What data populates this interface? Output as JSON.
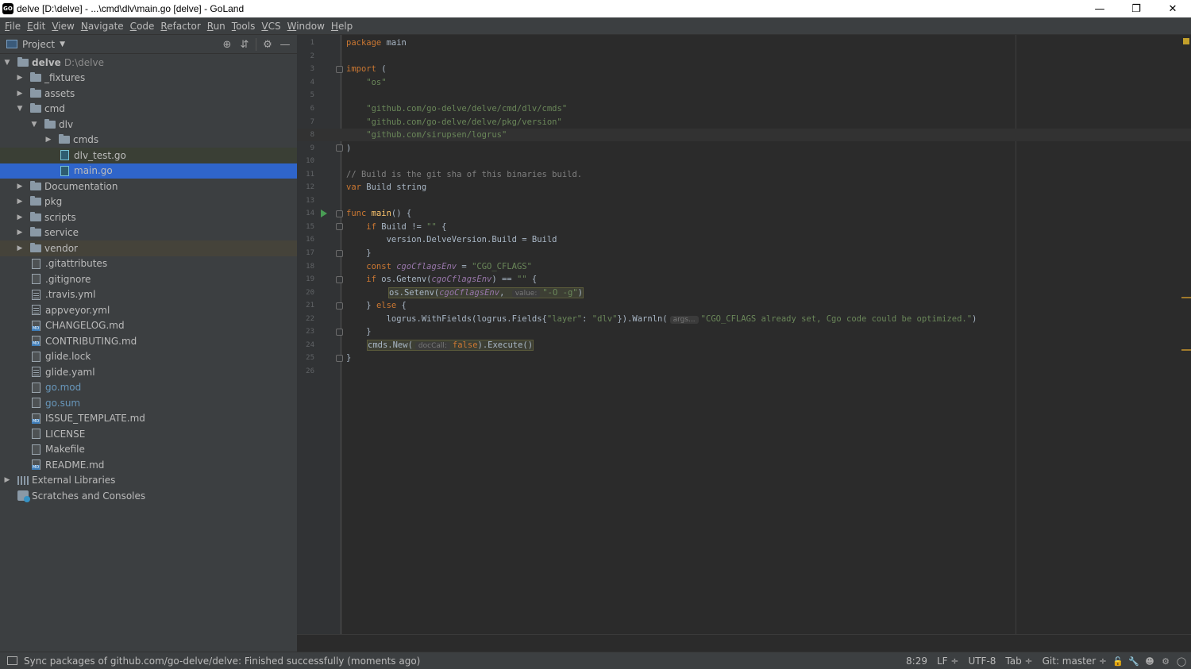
{
  "window": {
    "title": "delve [D:\\delve] - ...\\cmd\\dlv\\main.go [delve] - GoLand",
    "app_icon": "GO",
    "minimize": "—",
    "restore": "❐",
    "close": "✕"
  },
  "menu": [
    "File",
    "Edit",
    "View",
    "Navigate",
    "Code",
    "Refactor",
    "Run",
    "Tools",
    "VCS",
    "Window",
    "Help"
  ],
  "project": {
    "header": "Project",
    "root": {
      "name": "delve",
      "path": "D:\\delve"
    },
    "items": [
      {
        "label": "_fixtures"
      },
      {
        "label": "assets"
      },
      {
        "label": "cmd"
      },
      {
        "label": "dlv"
      },
      {
        "label": "cmds"
      },
      {
        "label": "dlv_test.go"
      },
      {
        "label": "main.go"
      },
      {
        "label": "Documentation"
      },
      {
        "label": "pkg"
      },
      {
        "label": "scripts"
      },
      {
        "label": "service"
      },
      {
        "label": "vendor"
      },
      {
        "label": ".gitattributes"
      },
      {
        "label": ".gitignore"
      },
      {
        "label": ".travis.yml"
      },
      {
        "label": "appveyor.yml"
      },
      {
        "label": "CHANGELOG.md"
      },
      {
        "label": "CONTRIBUTING.md"
      },
      {
        "label": "glide.lock"
      },
      {
        "label": "glide.yaml"
      },
      {
        "label": "go.mod"
      },
      {
        "label": "go.sum"
      },
      {
        "label": "ISSUE_TEMPLATE.md"
      },
      {
        "label": "LICENSE"
      },
      {
        "label": "Makefile"
      },
      {
        "label": "README.md"
      },
      {
        "label": "External Libraries"
      },
      {
        "label": "Scratches and Consoles"
      }
    ]
  },
  "editor": {
    "line_numbers": [
      "1",
      "2",
      "3",
      "4",
      "5",
      "6",
      "7",
      "8",
      "9",
      "10",
      "11",
      "12",
      "13",
      "14",
      "15",
      "16",
      "17",
      "18",
      "19",
      "20",
      "21",
      "22",
      "23",
      "24",
      "25",
      "26"
    ],
    "code": {
      "l1_kw": "package",
      "l1_rest": " main",
      "l3_kw": "import",
      "l3_rest": " (",
      "l4": "    \"os\"",
      "l6": "    \"github.com/go-delve/delve/cmd/dlv/cmds\"",
      "l7": "    \"github.com/go-delve/delve/pkg/version\"",
      "l8": "    \"github.com/sirupsen/logrus\"",
      "l9": ")",
      "l11": "// Build is the git sha of this binaries build.",
      "l12_kw": "var",
      "l12_rest": " Build string",
      "l14_kw": "func",
      "l14_fn": " main",
      "l14_rest": "() {",
      "l15_kw": "    if",
      "l15_rest": " Build != ",
      "l15_str": "\"\"",
      "l15_end": " {",
      "l16": "        version.DelveVersion.Build = Build",
      "l17": "    }",
      "l18_kw": "    const",
      "l18_var": " cgoCflagsEnv",
      "l18_eq": " = ",
      "l18_str": "\"CGO_CFLAGS\"",
      "l19_kw": "    if",
      "l19_a": " os.Getenv(",
      "l19_var": "cgoCflagsEnv",
      "l19_b": ") == ",
      "l19_str": "\"\"",
      "l19_c": " {",
      "l20_a": "os.Setenv(",
      "l20_var": "cgoCflagsEnv",
      "l20_b": ", ",
      "l20_hint": "value:",
      "l20_str": "\"-O -g\"",
      "l20_c": ")",
      "l21_a": "    } ",
      "l21_kw": "else",
      "l21_b": " {",
      "l22_a": "        logrus.WithFields(logrus.Fields{",
      "l22_s1": "\"layer\"",
      "l22_b": ": ",
      "l22_s2": "\"dlv\"",
      "l22_c": "}).Warnln(",
      "l22_hint": "args...",
      "l22_s3": "\"CGO_CFLAGS already set, Cgo code could be optimized.\"",
      "l22_d": ")",
      "l23": "    }",
      "l24_a": "cmds.New(",
      "l24_hint": "docCall:",
      "l24_kw": "false",
      "l24_b": ").Execute()",
      "l25": "}"
    }
  },
  "status": {
    "message": "Sync packages of github.com/go-delve/delve: Finished successfully (moments ago)",
    "position": "8:29",
    "line_sep": "LF ÷",
    "encoding": "UTF-8",
    "indent": "Tab ÷",
    "git": "Git: master ÷"
  }
}
